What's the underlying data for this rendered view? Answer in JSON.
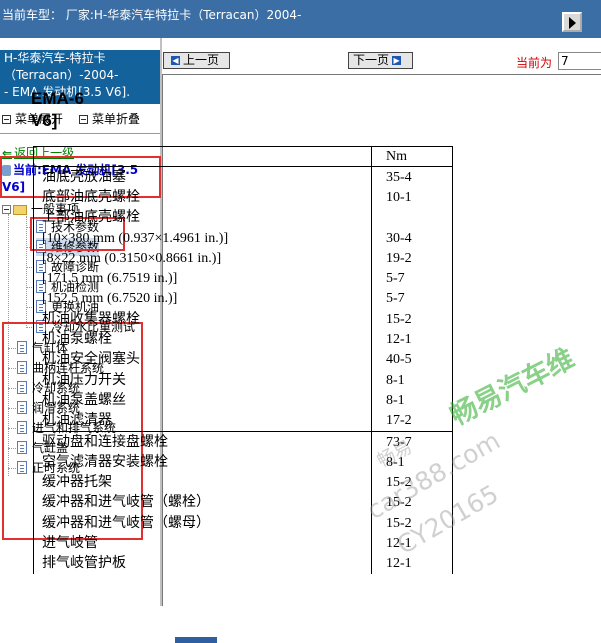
{
  "window": {
    "title": "当前车型：  厂家:H-华泰汽车特拉卡（Terracan）2004-",
    "button_icon": "play-icon"
  },
  "sidebar": {
    "header_lines": [
      "H-华泰汽车-特拉卡",
      "（Terracan）-2004-",
      "- EMA 发动机[3.5 V6]."
    ],
    "expand_label": "菜单展开",
    "collapse_label": "菜单折叠",
    "back_label": "返回上一级",
    "current_label": "当前:EMA 发动机[3.5 V6]",
    "tree": {
      "root": "一般事项",
      "children": [
        "技术参数",
        "维修参数",
        "故障诊断",
        "机油检测",
        "更换机油",
        "冷却水比重测试"
      ],
      "siblings": [
        "气缸体",
        "曲柄连杆系统",
        "冷却系统",
        "润滑系统",
        "进气和排气系统",
        "气缸盖",
        "正时系统"
      ]
    },
    "selected_item": "维修参数"
  },
  "toolbar": {
    "prev_label": "上一页",
    "next_label": "下一页",
    "current_page_label": "当前为",
    "current_page_value": "7"
  },
  "document": {
    "title_line1": "EMA-6",
    "title_line2": "V6]",
    "unit_header": "Nm",
    "rows": [
      {
        "label": "油底壳放油塞",
        "value": "35-4"
      },
      {
        "label": "底部油底壳螺栓",
        "value": "10-1"
      },
      {
        "label": "上部油底壳螺栓",
        "value": ""
      },
      {
        "label": "[10×380 mm (0.937×1.4961 in.)]",
        "value": "30-4"
      },
      {
        "label": "[8×22 mm (0.3150×0.8661 in.)]",
        "value": "19-2"
      },
      {
        "label": "[171.5 mm (6.7519 in.)]",
        "value": "5-7"
      },
      {
        "label": "[152.5 mm (6.7520 in.)]",
        "value": "5-7"
      },
      {
        "label": "机油收集器螺栓",
        "value": "15-2"
      },
      {
        "label": "机油泵螺栓",
        "value": "12-1"
      },
      {
        "label": "机油安全阀塞头",
        "value": "40-5"
      },
      {
        "label": "机油压力开关",
        "value": "8-1"
      },
      {
        "label": "机油泵盖螺丝",
        "value": "8-1"
      },
      {
        "label": "机油滤清器",
        "value": "17-2"
      },
      {
        "label": "驱动盘和连接盘螺栓",
        "value": "73-7"
      },
      {
        "label": "空气滤清器安装螺栓",
        "value": "8-1"
      },
      {
        "label": "缓冲器托架",
        "value": "15-2"
      },
      {
        "label": "缓冲器和进气岐管（螺栓）",
        "value": "15-2"
      },
      {
        "label": "缓冲器和进气岐管（螺母）",
        "value": "15-2"
      },
      {
        "label": "进气岐管",
        "value": "12-1"
      },
      {
        "label": "排气岐管护板",
        "value": "12-1"
      }
    ]
  },
  "watermark": {
    "brand": "畅易汽车维",
    "site_cn": "畅易",
    "site": "car388.com",
    "code": "CY20165"
  },
  "colors": {
    "titlebar": "#3a6ea5",
    "sidebar_header": "#14629c",
    "highlight_box": "#e03030",
    "link_green": "#008000",
    "current_blue": "#0000cc",
    "page_label_red": "#d00000"
  }
}
